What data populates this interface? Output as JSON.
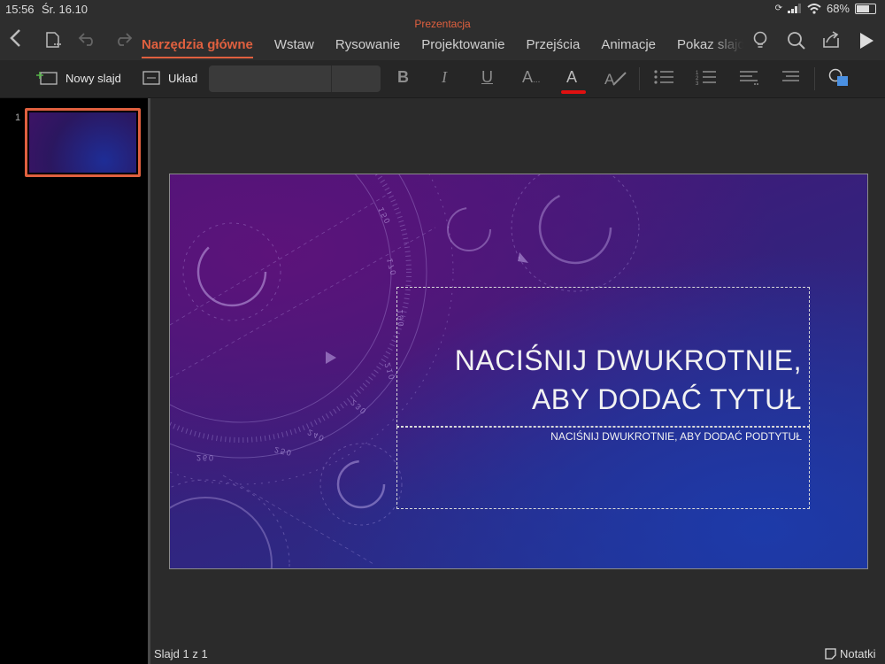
{
  "status_bar": {
    "time": "15:56",
    "date": "Śr. 16.10",
    "battery": "68%",
    "battery_fraction": 0.68
  },
  "document": {
    "title": "Prezentacja"
  },
  "toolbar": {
    "tabs": [
      {
        "label": "Narzędzia główne",
        "active": true
      },
      {
        "label": "Wstaw",
        "active": false
      },
      {
        "label": "Rysowanie",
        "active": false
      },
      {
        "label": "Projektowanie",
        "active": false
      },
      {
        "label": "Przejścia",
        "active": false
      },
      {
        "label": "Animacje",
        "active": false
      },
      {
        "label": "Pokaz slajdów",
        "active": false
      }
    ]
  },
  "ribbon": {
    "new_slide_label": "Nowy slajd",
    "layout_label": "Układ",
    "bold_glyph": "B",
    "italic_glyph": "I",
    "underline_glyph": "U",
    "font_size_glyph": "A",
    "font_color_glyph": "A",
    "font_color": "#e01010",
    "accent_color": "#e0603f"
  },
  "slides_pane": {
    "slides": [
      {
        "number": "1",
        "selected": true
      }
    ]
  },
  "slide": {
    "title": "NACIŚNIJ DWUKROTNIE, ABY DODAĆ TYTUŁ",
    "subtitle": "NACIŚNIJ DWUKROTNIE, ABY DODAĆ PODTYTUŁ",
    "dial_labels": [
      "150",
      "170",
      "190",
      "210",
      "230",
      "240",
      "250",
      "260"
    ]
  },
  "footer": {
    "slide_count": "Slajd 1 z 1",
    "notes_label": "Notatki"
  }
}
